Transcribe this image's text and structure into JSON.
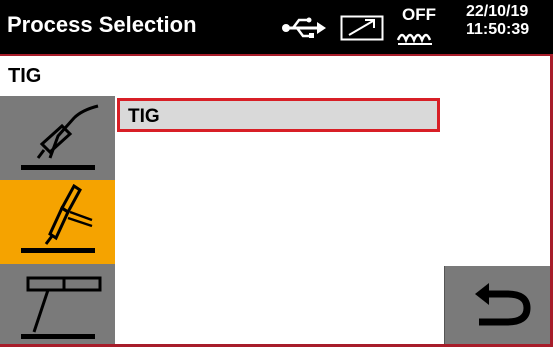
{
  "header": {
    "title": "Process Selection",
    "status_off": "OFF",
    "date": "22/10/19",
    "time": "11:50:39"
  },
  "subtitle": "TIG",
  "sidebar": {
    "items": [
      {
        "icon": "mig-torch-icon",
        "selected": false
      },
      {
        "icon": "tig-torch-icon",
        "selected": true
      },
      {
        "icon": "mma-electrode-icon",
        "selected": false
      }
    ]
  },
  "list": {
    "items": [
      {
        "label": "TIG",
        "selected": true
      }
    ]
  },
  "colors": {
    "frame": "#a71d2a",
    "selected_side": "#f5a300",
    "unselected_side": "#7a7a7a",
    "highlight_border": "#d81f26"
  }
}
